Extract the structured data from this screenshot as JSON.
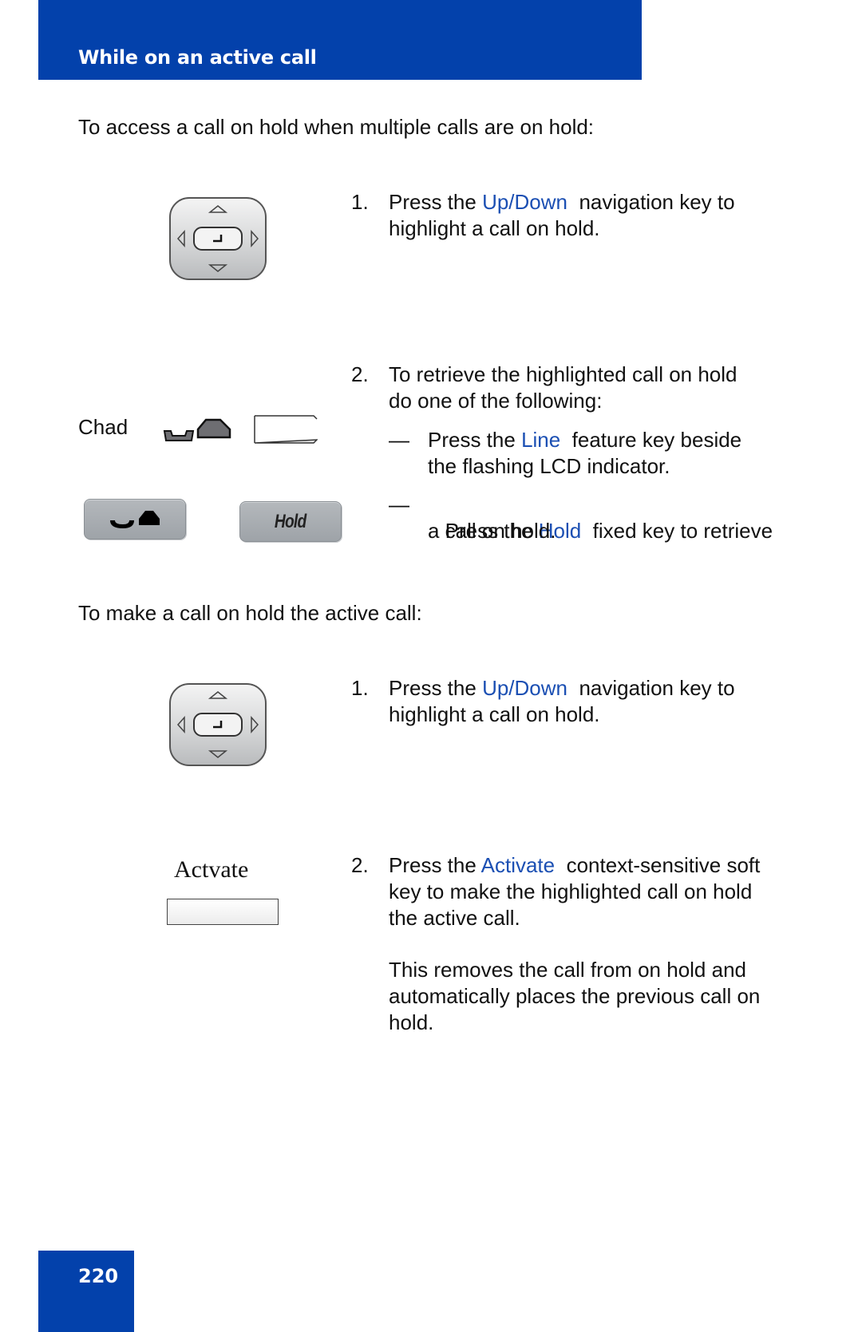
{
  "header": {
    "title": "While on an active call"
  },
  "section1": {
    "intro": "To access a call on hold when multiple calls are on hold:",
    "steps": [
      {
        "number": "1.",
        "line1_pre": "Press the ",
        "line1_key": "Up/Down",
        "line1_post": "  navigation key to",
        "line2": "highlight a call on hold."
      },
      {
        "number": "2.",
        "line1": "To retrieve the highlighted call on hold",
        "line2": "do one of the following:",
        "options": [
          {
            "dash": "—",
            "line1_pre": "Press the ",
            "line1_key": "Line",
            "line1_post": "  feature key beside",
            "line2": "the flashing LCD indicator."
          },
          {
            "dash": "—",
            "line1_pre": " Press the ",
            "line1_key": "Hold",
            "line1_post": "  fixed key to retrieve",
            "line2": "a call on hold."
          }
        ]
      }
    ],
    "display_line_label": "Chad",
    "hold_key_label": "Hold"
  },
  "section2": {
    "intro": "To make a call on hold the active call:",
    "steps": [
      {
        "number": "1.",
        "line1_pre": "Press the ",
        "line1_key": "Up/Down",
        "line1_post": "  navigation key to",
        "line2": "highlight a call on hold."
      },
      {
        "number": "2.",
        "line1_pre": "Press the ",
        "line1_key": "Activate",
        "line1_post": "  context-sensitive soft",
        "line2": "key to make the highlighted call on hold",
        "line3": "the active call.",
        "note_lines": [
          "This removes the call from on hold and",
          "automatically places the previous call on",
          "hold."
        ]
      }
    ],
    "softkey_label": "Actvate"
  },
  "footer": {
    "page_number": "220"
  },
  "colors": {
    "brand_blue": "#0341ab",
    "highlight_text": "#1b4fb3"
  }
}
